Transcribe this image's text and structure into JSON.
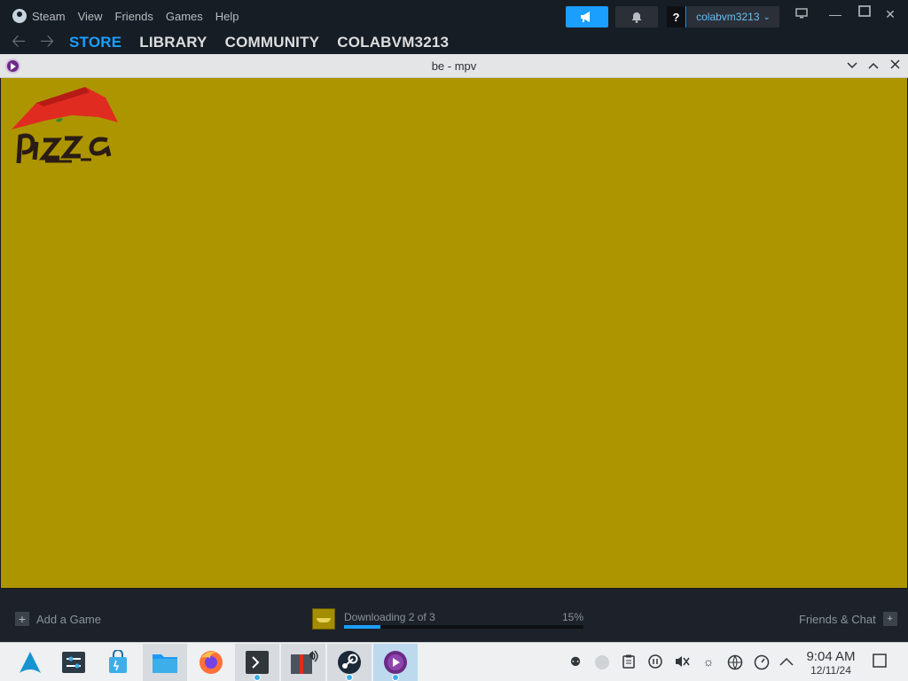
{
  "steam": {
    "menu": [
      "Steam",
      "View",
      "Friends",
      "Games",
      "Help"
    ],
    "help_label": "?",
    "account_name": "colabvm3213",
    "nav": {
      "store": "STORE",
      "library": "LIBRARY",
      "community": "COMMUNITY",
      "profile": "COLABVM3213"
    }
  },
  "mpv": {
    "title": "be - mpv",
    "logo_text": "Pizza Hut"
  },
  "bottom": {
    "add_game": "Add a Game",
    "download_text": "Downloading 2 of 3",
    "download_percent_label": "15%",
    "download_progress": 0.15,
    "friends_chat": "Friends & Chat"
  },
  "taskbar": {
    "time": "9:04 AM",
    "date": "12/11/24"
  },
  "colors": {
    "accent": "#1a9fff",
    "video_bg": "#ad9500"
  }
}
